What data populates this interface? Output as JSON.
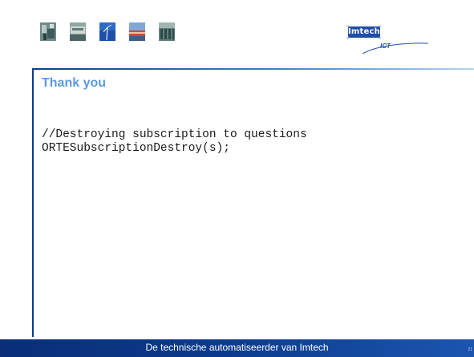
{
  "slide": {
    "title": "Thank you",
    "code_lines": [
      "//Destroying subscription to questions",
      "ORTESubscriptionDestroy(s);"
    ],
    "footer_text": "De technische automatiseerder van Imtech",
    "page_number": "21"
  },
  "logo": {
    "brand": "Imtech",
    "sub": "ICT"
  },
  "thumbnails": [
    {
      "name": "industrial-photo-thumbnail"
    },
    {
      "name": "building-photo-thumbnail"
    },
    {
      "name": "wind-turbine-photo-thumbnail"
    },
    {
      "name": "train-photo-thumbnail"
    },
    {
      "name": "office-building-photo-thumbnail"
    }
  ],
  "colors": {
    "title": "#5d9bdc",
    "footer": "#0c3a8c",
    "brand_blue": "#1f4ea5"
  }
}
